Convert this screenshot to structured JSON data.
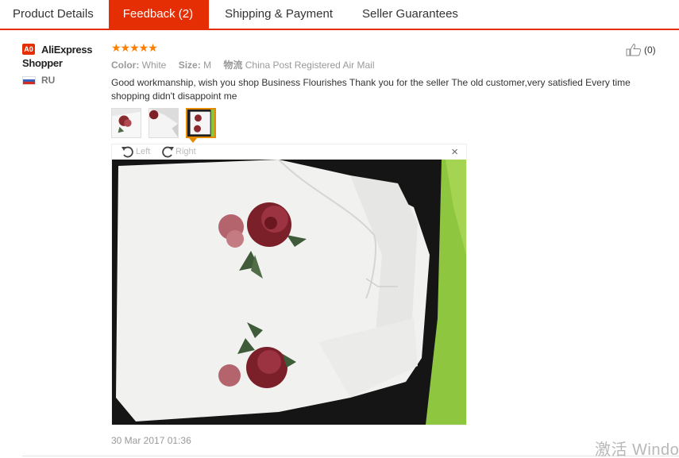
{
  "tabs": [
    {
      "label": "Product Details",
      "active": false
    },
    {
      "label": "Feedback (2)",
      "active": true
    },
    {
      "label": "Shipping & Payment",
      "active": false
    },
    {
      "label": "Seller Guarantees",
      "active": false
    }
  ],
  "review": {
    "user": {
      "badge": "A0",
      "name": "AliExpress Shopper",
      "country": "RU"
    },
    "stars": "★★★★★",
    "rating": 5,
    "meta": {
      "color_label": "Color:",
      "color_value": "White",
      "size_label": "Size:",
      "size_value": "M",
      "shipping_label": "物流",
      "shipping_value": "China Post Registered Air Mail"
    },
    "helpful_count": "(0)",
    "text": "Good workmanship, wish you shop Business Flourishes Thank you for the seller The old customer,very satisfied Every time shopping didn't disappoint me",
    "viewer": {
      "rotate_left": "Left",
      "rotate_right": "Right",
      "close": "×"
    },
    "date": "30 Mar 2017 01:36"
  },
  "watermark": "激活 Windo",
  "colors": {
    "accent": "#e62e04",
    "star": "#ff7e00",
    "selected_thumb": "#e68a00"
  }
}
